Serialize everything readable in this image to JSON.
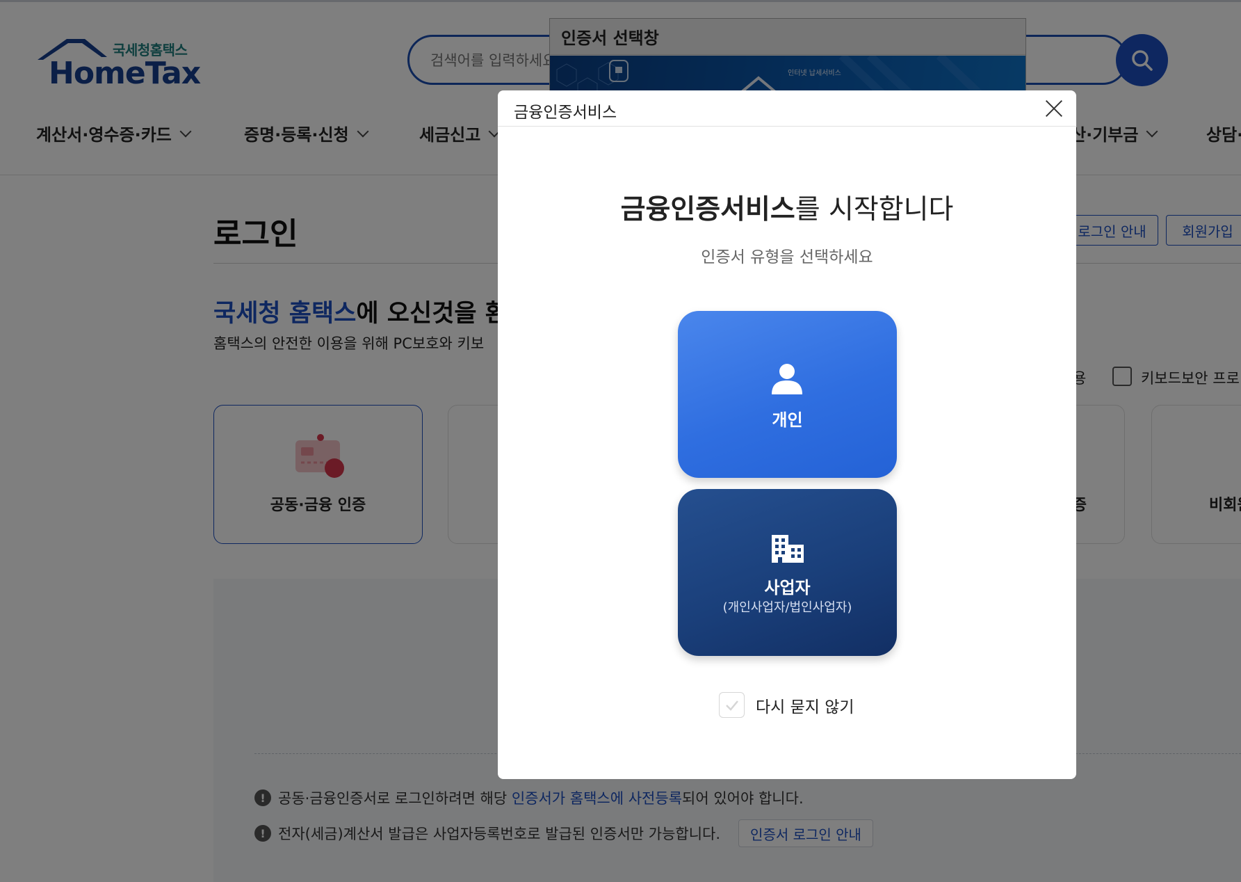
{
  "header": {
    "logo_kr": "국세청홈택스",
    "logo_en": "HomeTax",
    "search_placeholder": "검색어를 입력하세요"
  },
  "gnb": [
    {
      "label": "계산서·영수증·카드"
    },
    {
      "label": "증명·등록·신청"
    },
    {
      "label": "세금신고"
    },
    {
      "label": "산·기부금"
    },
    {
      "label": "상담·"
    }
  ],
  "login_page": {
    "title": "로그인",
    "login_guide_btn": "로그인 안내",
    "signup_btn": "회원가입",
    "welcome_blue": "국세청 홈택스",
    "welcome_rest": "에 오신것을 환",
    "welcome_sub": "홈택스의 안전한 이용을 위해 PC보호와 키보",
    "option_partial": "용",
    "keyboard_option": "키보드보안 프로",
    "cards": [
      {
        "label": "공동·금융 인증"
      },
      {
        "label": "증"
      },
      {
        "label": "비회원"
      }
    ],
    "notices": [
      {
        "pre": "공동·금융인증서로 로그인하려면 해당 ",
        "link": "인증서가 홈택스에 사전등록",
        "post": "되어 있어야 합니다."
      },
      {
        "pre": "전자(세금)계산서 발급은 사업자등록번호로 발급된 인증서만 가능합니다.",
        "button": "인증서 로그인 안내"
      }
    ]
  },
  "cert_window": {
    "title": "인증서 선택창",
    "banner_text": "인터넷 납세서비스"
  },
  "modal": {
    "header_title": "금융인증서비스",
    "heading_bold": "금융인증서비스",
    "heading_rest": "를 시작합니다",
    "subheading": "인증서 유형을 선택하세요",
    "personal_label": "개인",
    "business_label": "사업자",
    "business_sublabel": "(개인사업자/법인사업자)",
    "dont_ask_label": "다시 묻지 않기"
  },
  "colors": {
    "brand_blue": "#1d4fc1",
    "personal_btn": "#2f6ee0",
    "business_btn": "#1a3f7a",
    "overlay": "rgba(0,0,0,0.5)"
  }
}
